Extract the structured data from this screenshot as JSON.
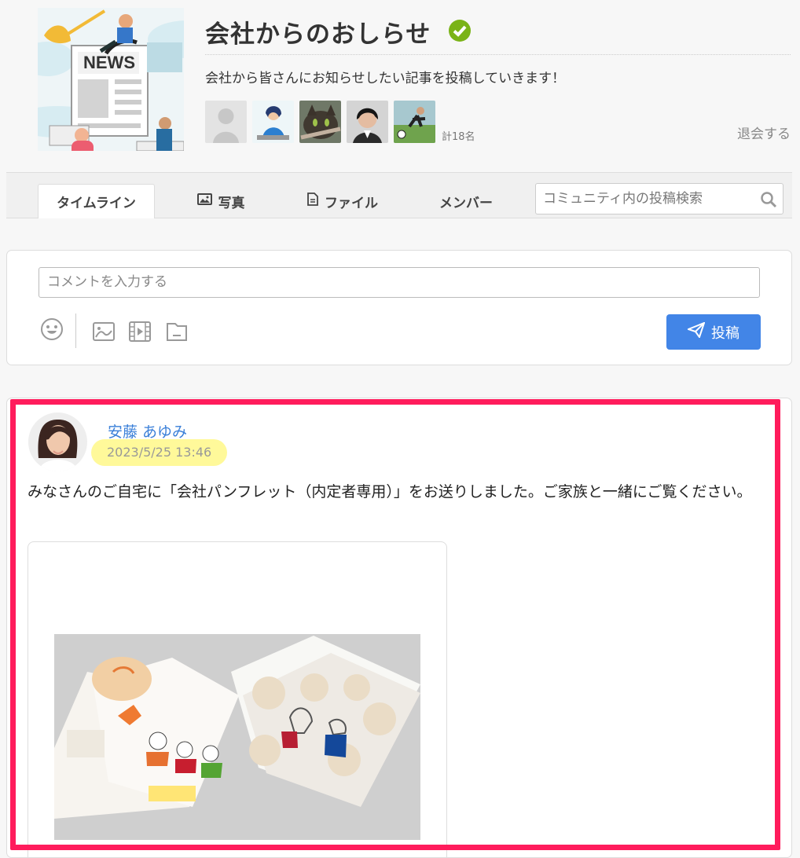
{
  "community": {
    "title": "会社からのおしらせ",
    "description": "会社から皆さんにお知らせしたい記事を投稿していきます！",
    "cover_text": "NEWS",
    "member_count": "計18名",
    "leave_label": "退会する"
  },
  "tabs": {
    "timeline": "タイムライン",
    "photos": "写真",
    "files": "ファイル",
    "members": "メンバー"
  },
  "search": {
    "placeholder": "コミュニティ内の投稿検索"
  },
  "composer": {
    "placeholder": "コメントを入力する",
    "post_label": "投稿"
  },
  "post": {
    "author": "安藤 あゆみ",
    "timestamp": "2023/5/25 13:46",
    "text": "みなさんのご自宅に「会社パンフレット（内定者専用）」をお送りしました。ご家族と一緒にご覧ください。"
  },
  "colors": {
    "accent": "#4285e7",
    "verified": "#7ab317",
    "highlight": "#ff1c5c",
    "author_link": "#3a7fd8",
    "timestamp_bg": "#fff99a"
  },
  "icons": [
    "verified-check-icon",
    "image-icon",
    "file-icon",
    "search-icon",
    "emoji-icon",
    "photo-upload-icon",
    "video-upload-icon",
    "file-upload-icon",
    "send-icon"
  ]
}
